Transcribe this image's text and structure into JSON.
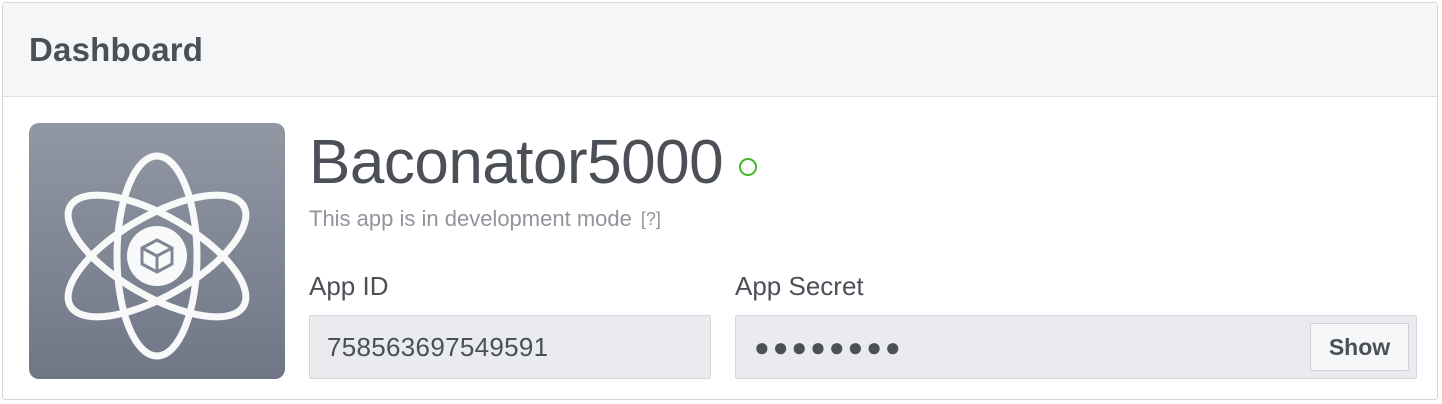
{
  "header": {
    "title": "Dashboard"
  },
  "app": {
    "icon": "atom-cube-icon",
    "name": "Baconator5000",
    "status_icon": "status-circle-icon",
    "status_color": "#42b72a",
    "mode_text": "This app is in development mode",
    "help_link": "[?]"
  },
  "fields": {
    "app_id_label": "App ID",
    "app_id_value": "758563697549591",
    "app_secret_label": "App Secret",
    "app_secret_value": "●●●●●●●●",
    "show_label": "Show"
  }
}
